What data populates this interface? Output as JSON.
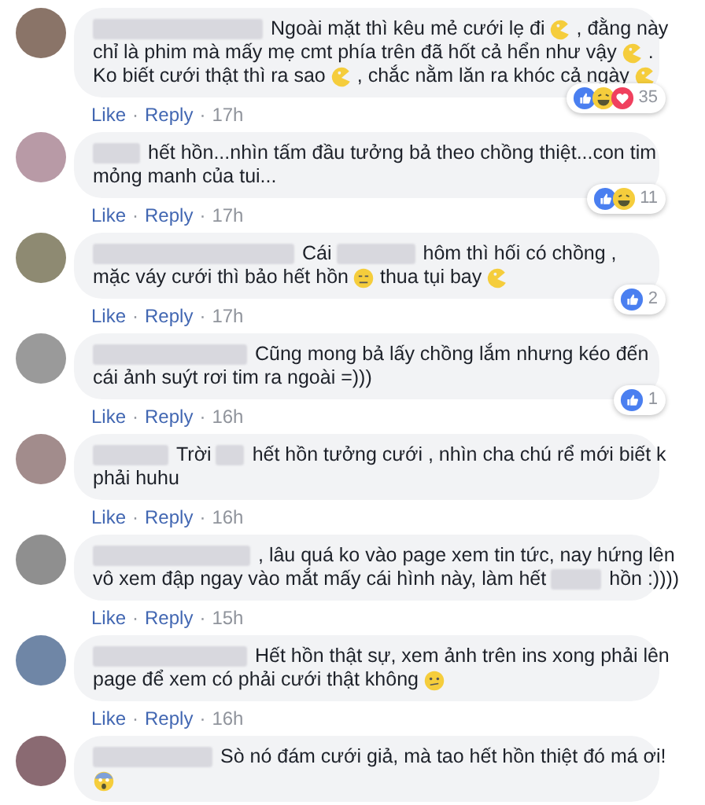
{
  "comments": [
    {
      "color": "#8a7468",
      "lines": [
        [
          {
            "kind": "blur"
          },
          {
            "kind": "text",
            "text": "Ngoài mặt thì kêu mẻ cưới lẹ đi"
          },
          {
            "kind": "pacman"
          },
          {
            "kind": "text",
            "text": ", đằng này"
          }
        ],
        [
          {
            "kind": "text",
            "text": "chỉ là phim mà mấy mẹ cmt phía trên đã hốt cả hển như vậy"
          },
          {
            "kind": "pacman"
          },
          {
            "kind": "text",
            "text": "."
          }
        ],
        [
          {
            "kind": "text",
            "text": "Ko biết cưới thật thì ra sao"
          },
          {
            "kind": "pacman"
          },
          {
            "kind": "text",
            "text": ", chắc nằm lăn ra khóc cả ngày"
          },
          {
            "kind": "pacman"
          }
        ]
      ],
      "reactions": [
        {
          "kind": "like"
        },
        {
          "kind": "haha"
        },
        {
          "kind": "love"
        }
      ],
      "reaction_count": "35",
      "like": "Like",
      "sep": "·",
      "reply": "Reply",
      "time": "17h"
    },
    {
      "color": "#b89aa6",
      "lines": [
        [
          {
            "kind": "blur"
          },
          {
            "kind": "text",
            "text": "hết hồn...nhìn tấm đầu tưởng bả theo chồng thiệt...con tim"
          }
        ],
        [
          {
            "kind": "text",
            "text": "mỏng manh của tui..."
          }
        ]
      ],
      "reactions": [
        {
          "kind": "like"
        },
        {
          "kind": "haha"
        }
      ],
      "reaction_count": "11",
      "like": "Like",
      "sep": "·",
      "reply": "Reply",
      "time": "17h"
    },
    {
      "color": "#8e8a72",
      "lines": [
        [
          {
            "kind": "blur"
          },
          {
            "kind": "text",
            "text": "Cái"
          },
          {
            "kind": "blur"
          },
          {
            "kind": "text",
            "text": "hôm thì hối có chồng ,"
          }
        ],
        [
          {
            "kind": "text",
            "text": "mặc váy cưới thì bảo hết hồn"
          },
          {
            "kind": "neutral"
          },
          {
            "kind": "text",
            "text": "thua tụi bay"
          },
          {
            "kind": "pacman"
          }
        ]
      ],
      "reactions": [
        {
          "kind": "like"
        }
      ],
      "reaction_count": "2",
      "like": "Like",
      "sep": "·",
      "reply": "Reply",
      "time": "17h"
    },
    {
      "color": "#9a9a9a",
      "lines": [
        [
          {
            "kind": "blur"
          },
          {
            "kind": "text",
            "text": "Cũng mong bả lấy chồng lắm nhưng kéo đến"
          }
        ],
        [
          {
            "kind": "text",
            "text": "cái ảnh suýt rơi tim ra ngoài =)))"
          }
        ]
      ],
      "reactions": [
        {
          "kind": "like"
        }
      ],
      "reaction_count": "1",
      "like": "Like",
      "sep": "·",
      "reply": "Reply",
      "time": "16h"
    },
    {
      "color": "#a28c8c",
      "lines": [
        [
          {
            "kind": "blur"
          },
          {
            "kind": "text",
            "text": "Trời"
          },
          {
            "kind": "blur"
          },
          {
            "kind": "text",
            "text": "hết hồn tưởng cưới , nhìn cha chú rể mới biết k"
          }
        ],
        [
          {
            "kind": "text",
            "text": "phải huhu"
          }
        ]
      ],
      "like": "Like",
      "sep": "·",
      "reply": "Reply",
      "time": "16h"
    },
    {
      "color": "#8f8f8f",
      "lines": [
        [
          {
            "kind": "blur"
          },
          {
            "kind": "text",
            "text": ", lâu quá ko vào page xem tin tức, nay hứng lên"
          }
        ],
        [
          {
            "kind": "text",
            "text": "vô xem đập ngay vào mắt mấy cái hình này, làm hết"
          },
          {
            "kind": "blur"
          },
          {
            "kind": "text",
            "text": "hồn :))))"
          }
        ]
      ],
      "like": "Like",
      "sep": "·",
      "reply": "Reply",
      "time": "15h"
    },
    {
      "color": "#6f86a6",
      "lines": [
        [
          {
            "kind": "blur"
          },
          {
            "kind": "text",
            "text": "Hết hồn thật sự, xem ảnh trên ins xong phải lên"
          }
        ],
        [
          {
            "kind": "text",
            "text": "page để xem có phải cưới thật không"
          },
          {
            "kind": "confused"
          }
        ]
      ],
      "like": "Like",
      "sep": "·",
      "reply": "Reply",
      "time": "16h"
    },
    {
      "color": "#8a6a72",
      "lines": [
        [
          {
            "kind": "blur"
          },
          {
            "kind": "text",
            "text": "Sò nó đám cưới giả, mà tao hết hồn thiệt đó má ơi!"
          }
        ],
        [
          {
            "kind": "scream"
          }
        ]
      ]
    }
  ]
}
